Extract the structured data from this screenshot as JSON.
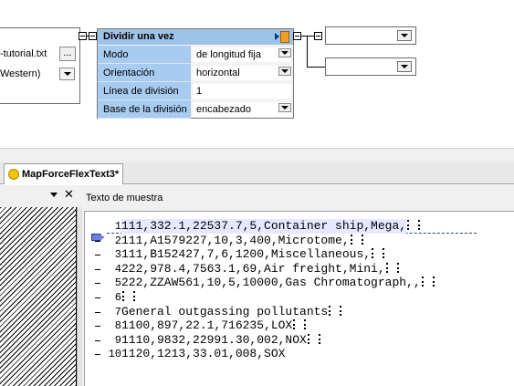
{
  "mapping": {
    "source_file": {
      "name": "-tutorial.txt",
      "browse_label": "...",
      "encoding": "Western)"
    },
    "split_component": {
      "title": "Dividir una vez",
      "properties": [
        {
          "label": "Modo",
          "value": "de longitud fija",
          "has_dropdown": true
        },
        {
          "label": "Orientación",
          "value": "horizontal",
          "has_dropdown": true
        },
        {
          "label": "Línea de división",
          "value": "1",
          "has_dropdown": false
        },
        {
          "label": "Base de la división",
          "value": "encabezado",
          "has_dropdown": true
        }
      ]
    },
    "targets": [
      {
        "value": ""
      },
      {
        "value": ""
      }
    ]
  },
  "tabs": [
    {
      "label": "MapForceFlexText3*",
      "active": true
    }
  ],
  "sample_panel": {
    "title": "Texto de muestra",
    "close_glyph": "✕"
  },
  "sample_text": [
    {
      "n": "1",
      "text": "111,332.1,22537.7,5,Container ship,Mega,",
      "highlight": true
    },
    {
      "n": "2",
      "text": "111,A1579227,10,3,400,Microtome,",
      "highlight": false
    },
    {
      "n": "3",
      "text": "111,B152427,7,6,1200,Miscellaneous,",
      "highlight": false
    },
    {
      "n": "4",
      "text": "222,978.4,7563.1,69,Air freight,Mini,",
      "highlight": false
    },
    {
      "n": "5",
      "text": "222,ZZAW561,10,5,10000,Gas Chromatograph,,",
      "highlight": false
    },
    {
      "n": "6",
      "text": "",
      "highlight": false
    },
    {
      "n": "7",
      "text": "General outgassing pollutants",
      "highlight": false
    },
    {
      "n": "8",
      "text": "1100,897,22.1,716235,LOX",
      "highlight": false
    },
    {
      "n": "9",
      "text": "1110,9832,22991.30,002,NOX",
      "highlight": false
    },
    {
      "n": "10",
      "text": "1120,1213,33.01,008,SOX",
      "highlight": false
    }
  ],
  "colors": {
    "component_header": "#9ec3e8",
    "property_label_bg": "#a8cbf0",
    "highlight_line": "#e5e8ff",
    "split_marker": "#6b7fe0"
  }
}
